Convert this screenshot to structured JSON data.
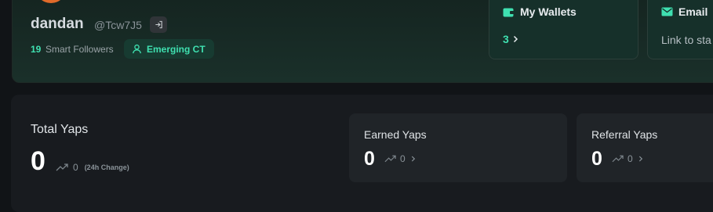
{
  "profile": {
    "name": "dandan",
    "handle": "@Tcw7J5",
    "smart_followers_count": "19",
    "smart_followers_label": "Smart Followers",
    "badge": {
      "icon": "user-icon",
      "label": "Emerging CT"
    },
    "logout_icon": "logout-icon"
  },
  "wallets": {
    "icon": "wallet-icon",
    "title": "My Wallets",
    "count": "3"
  },
  "email": {
    "icon": "mail-icon",
    "title": "Email",
    "link": "Link to sta"
  },
  "total_yaps": {
    "title": "Total Yaps",
    "value": "0",
    "change": "0",
    "change_note": "(24h Change)"
  },
  "earned_yaps": {
    "title": "Earned Yaps",
    "value": "0",
    "change": "0"
  },
  "referral_yaps": {
    "title": "Referral Yaps",
    "value": "0",
    "change": "0"
  },
  "colors": {
    "accent": "#3fe0b0",
    "avatar": "#e06a2a"
  }
}
